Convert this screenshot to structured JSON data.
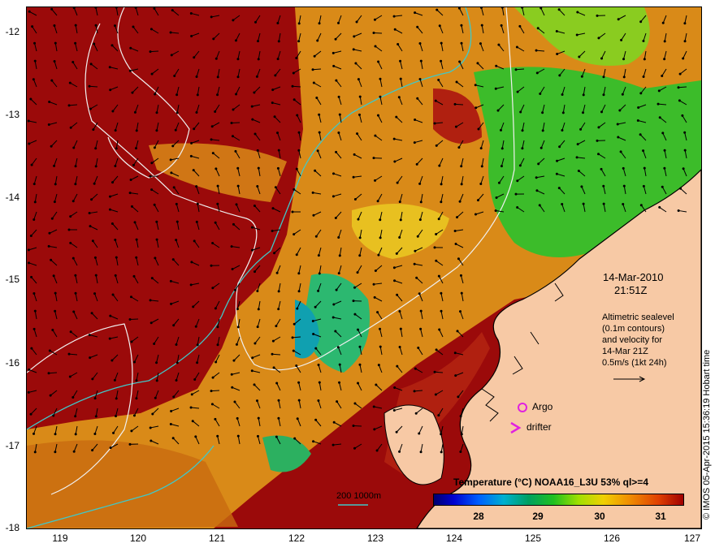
{
  "map": {
    "type": "sea-surface-temperature-map",
    "lon_ticks": [
      "119",
      "120",
      "121",
      "122",
      "123",
      "124",
      "125",
      "126",
      "127"
    ],
    "lat_ticks": [
      "-12",
      "-13",
      "-14",
      "-15",
      "-16",
      "-17",
      "-18"
    ],
    "lon_range": [
      118.6,
      127
    ],
    "lat_range": [
      -18,
      -11.8
    ]
  },
  "annotation": {
    "date": "14-Mar-2010",
    "time": "21:51Z",
    "line1": "Altimetric sealevel",
    "line2": "(0.1m contours)",
    "line3": "and velocity for",
    "line4": "14-Mar 21Z",
    "line5": "0.5m/s (1kt 24h)"
  },
  "legend": {
    "title": "Temperature (°C) NOAA16_L3U 53% ql>=4",
    "ticks": [
      "28",
      "29",
      "30",
      "31"
    ],
    "argo": "Argo",
    "drifter": "drifter",
    "scale_line": "200  1000m"
  },
  "credit": "© IMOS 05-Apr-2015 15:36:19 Hobart time",
  "colors": {
    "hot": "#9b0a0a",
    "warm": "#d98a18",
    "land": "#f7c9a5",
    "contour_cyan": "#40c8c8",
    "marker_magenta": "#e020e0"
  }
}
